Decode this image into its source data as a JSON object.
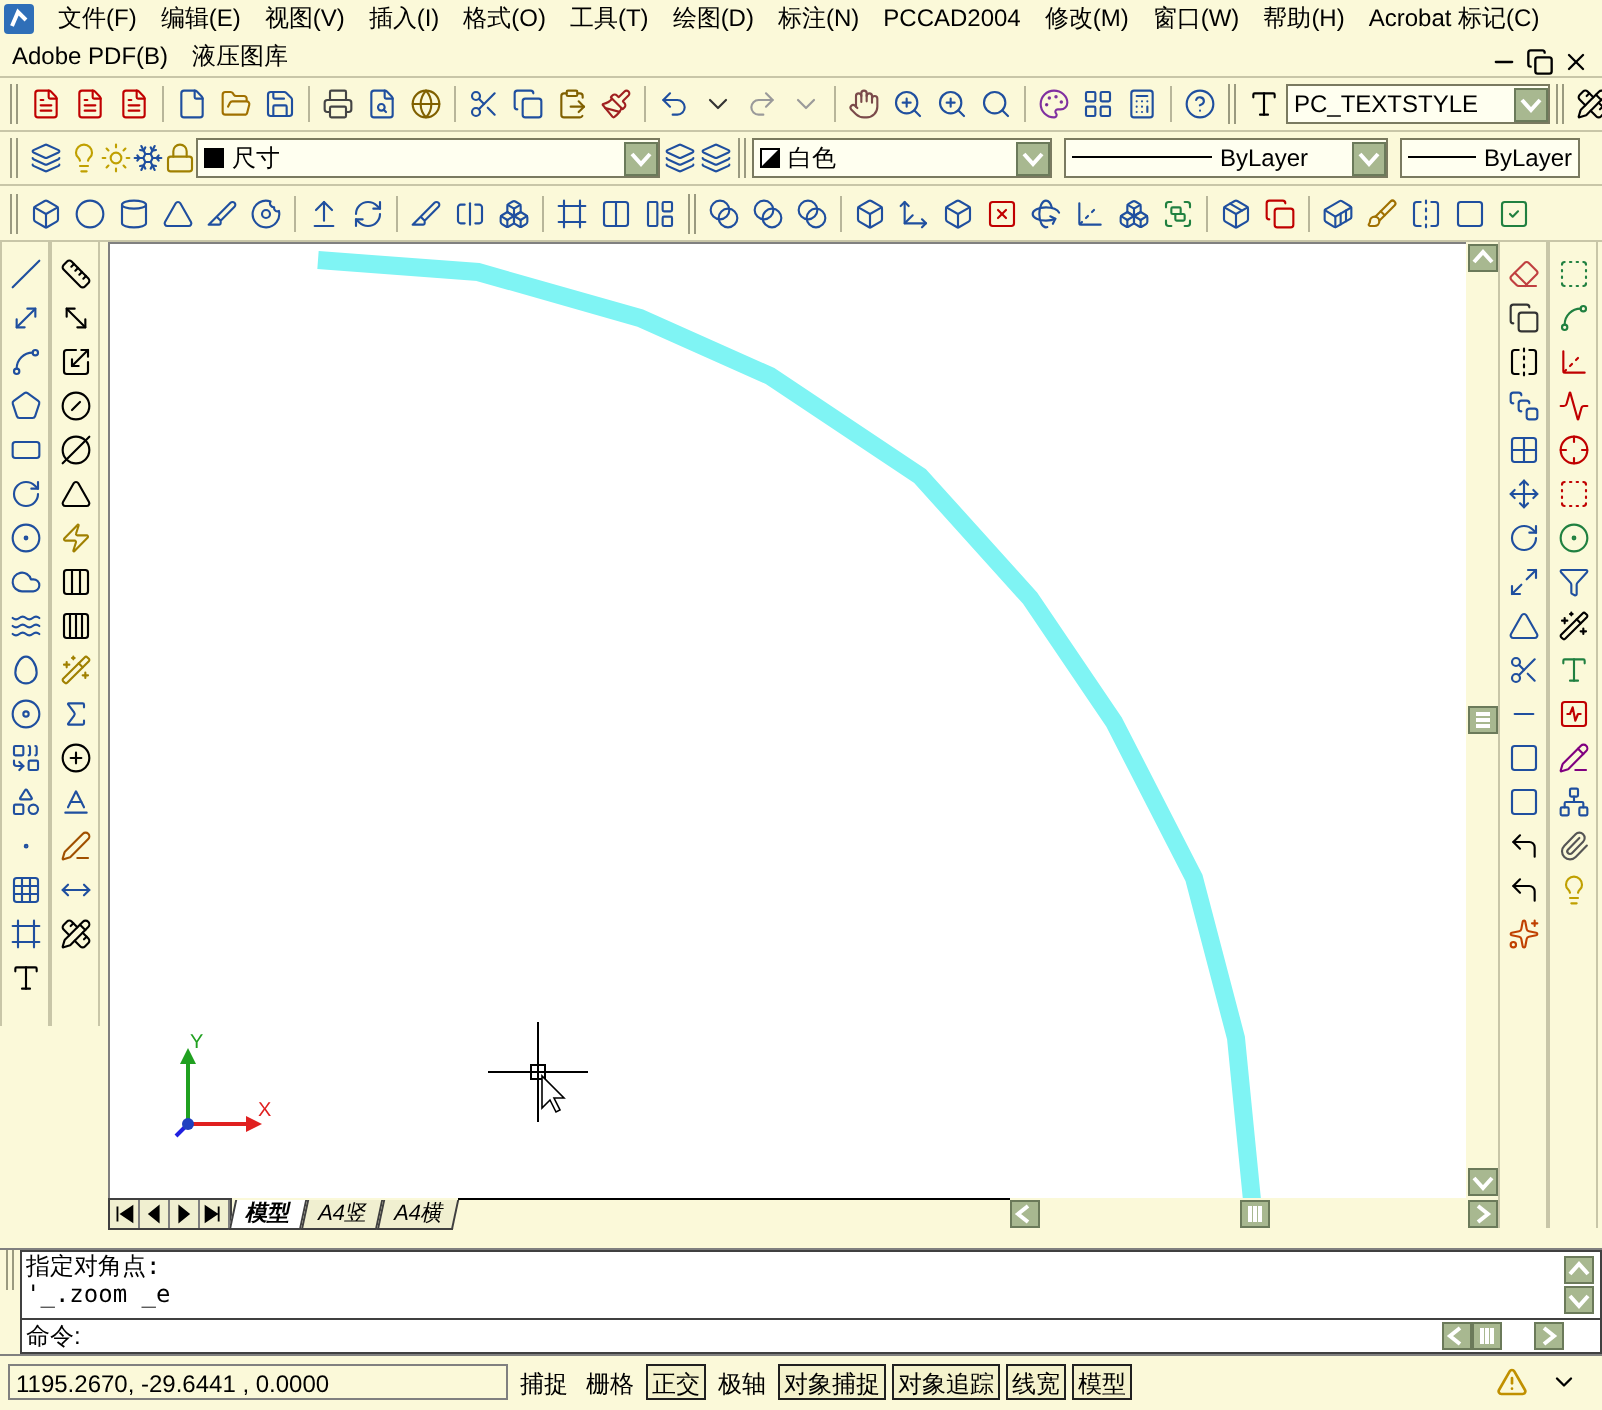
{
  "menu": [
    "文件(F)",
    "编辑(E)",
    "视图(V)",
    "插入(I)",
    "格式(O)",
    "工具(T)",
    "绘图(D)",
    "标注(N)",
    "PCCAD2004",
    "修改(M)",
    "窗口(W)",
    "帮助(H)",
    "Acrobat 标记(C)"
  ],
  "menu2": [
    "Adobe PDF(B)",
    "液压图库"
  ],
  "text_style": "PC_TEXTSTYLE",
  "layer": "尺寸",
  "color_control": {
    "value": "白色"
  },
  "linetype": "ByLayer",
  "lineweight": "ByLayer",
  "ucs": {
    "x_label": "X",
    "y_label": "Y"
  },
  "layout_tabs": [
    {
      "label": "模型",
      "selected": true
    },
    {
      "label": "A4竖",
      "selected": false
    },
    {
      "label": "A4横",
      "selected": false
    }
  ],
  "command": {
    "history": [
      "指定对角点:",
      "'_.zoom _e"
    ],
    "prompt": "命令:"
  },
  "status_bar": {
    "coordinates": "1195.2670, -29.6441 , 0.0000",
    "toggles": [
      {
        "label": "捕捉",
        "on": false
      },
      {
        "label": "栅格",
        "on": false
      },
      {
        "label": "正交",
        "on": true
      },
      {
        "label": "极轴",
        "on": false
      },
      {
        "label": "对象捕捉",
        "on": true
      },
      {
        "label": "对象追踪",
        "on": true
      },
      {
        "label": "线宽",
        "on": true
      },
      {
        "label": "模型",
        "on": true
      }
    ]
  }
}
